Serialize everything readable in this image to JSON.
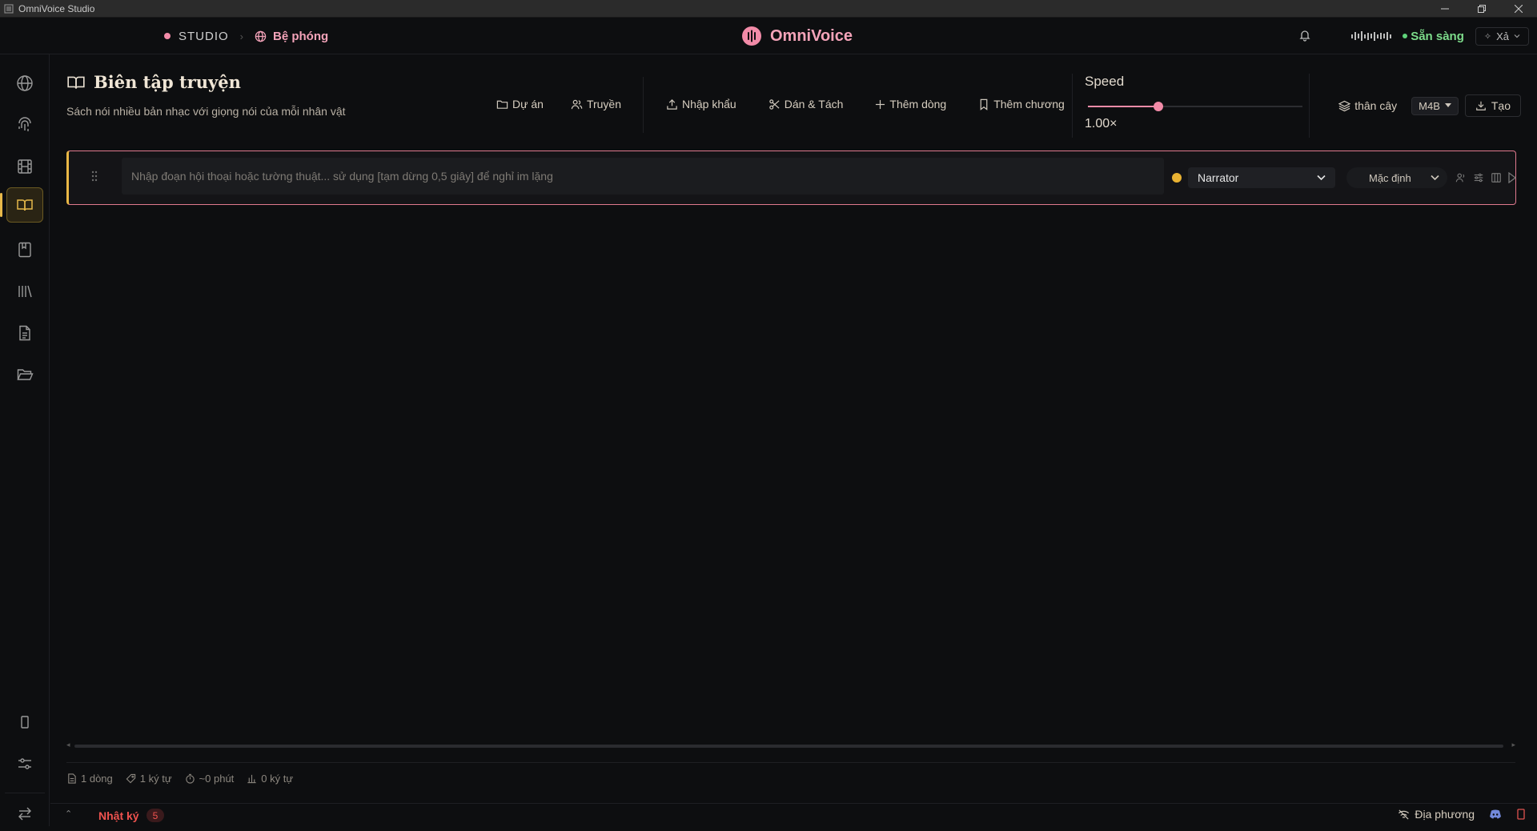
{
  "window": {
    "title": "OmniVoice Studio"
  },
  "header": {
    "breadcrumb_root": "STUDIO",
    "breadcrumb_current": "Bệ phóng",
    "brand": "OmniVoice",
    "status": "Sẵn sàng",
    "xa_button": "Xả"
  },
  "page": {
    "title": "Biên tập truyện",
    "subtitle": "Sách nói nhiều bản nhạc với giọng nói của mỗi nhân vật"
  },
  "toolbar": {
    "project": "Dự án",
    "story": "Truyền",
    "import": "Nhập khẩu",
    "paste_split": "Dán & Tách",
    "add_line": "Thêm dòng",
    "add_chapter": "Thêm chương"
  },
  "speed": {
    "label": "Speed",
    "value": "1.00×",
    "fraction": 0.33
  },
  "export": {
    "stems": "thân cây",
    "format": "M4B",
    "generate": "Tạo"
  },
  "row": {
    "placeholder": "Nhập đoạn hội thoại hoặc tường thuật... sử dụng [tạm dừng 0,5 giây] để nghỉ im lặng",
    "voice": "Narrator",
    "voice_color": "#e9b232",
    "style": "Mặc định"
  },
  "stats": {
    "lines": "1 dòng",
    "chars": "1 ký tự",
    "duration": "~0 phút",
    "words": "0 ký tự"
  },
  "footer": {
    "log_label": "Nhật ký",
    "log_count": "5",
    "mode": "Địa phương"
  },
  "colors": {
    "accent_pink": "#f28ba8",
    "accent_gold": "#e9b745",
    "status_green": "#7ddc8b",
    "log_red": "#f0534f"
  }
}
